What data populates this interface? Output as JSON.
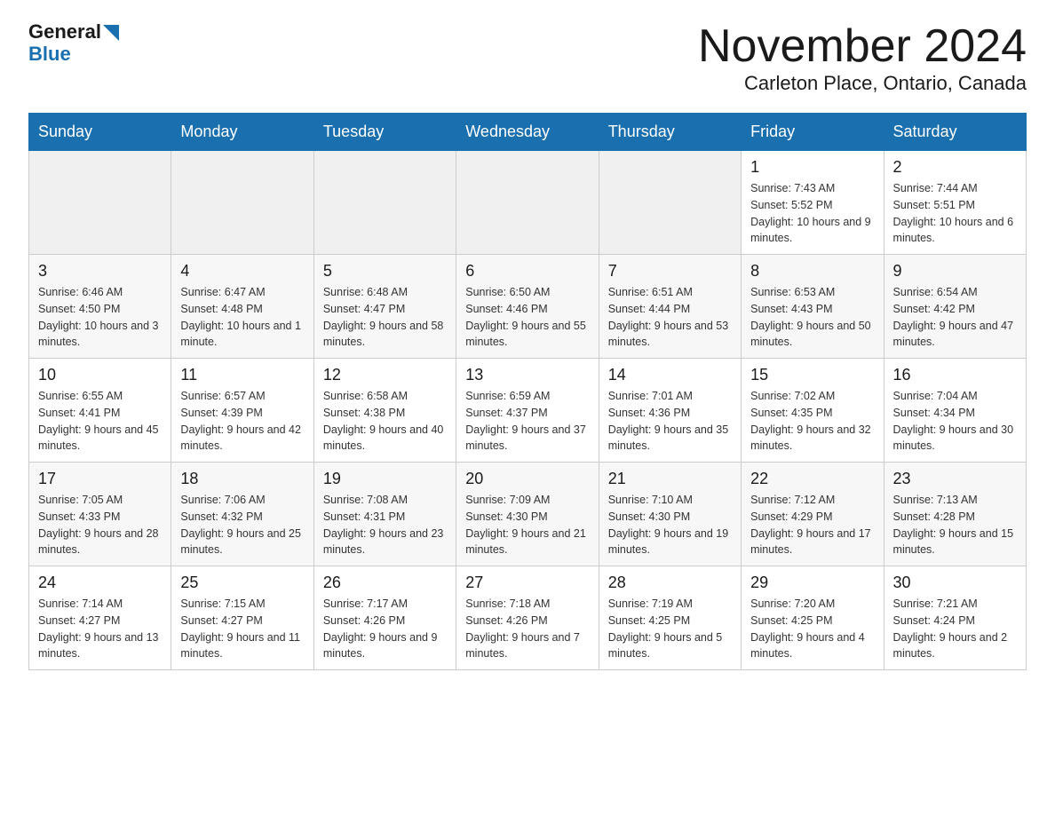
{
  "logo": {
    "line1": "General",
    "arrow": true,
    "line2": "Blue"
  },
  "title": "November 2024",
  "subtitle": "Carleton Place, Ontario, Canada",
  "days_of_week": [
    "Sunday",
    "Monday",
    "Tuesday",
    "Wednesday",
    "Thursday",
    "Friday",
    "Saturday"
  ],
  "weeks": [
    [
      {
        "day": "",
        "info": ""
      },
      {
        "day": "",
        "info": ""
      },
      {
        "day": "",
        "info": ""
      },
      {
        "day": "",
        "info": ""
      },
      {
        "day": "",
        "info": ""
      },
      {
        "day": "1",
        "info": "Sunrise: 7:43 AM\nSunset: 5:52 PM\nDaylight: 10 hours and 9 minutes."
      },
      {
        "day": "2",
        "info": "Sunrise: 7:44 AM\nSunset: 5:51 PM\nDaylight: 10 hours and 6 minutes."
      }
    ],
    [
      {
        "day": "3",
        "info": "Sunrise: 6:46 AM\nSunset: 4:50 PM\nDaylight: 10 hours and 3 minutes."
      },
      {
        "day": "4",
        "info": "Sunrise: 6:47 AM\nSunset: 4:48 PM\nDaylight: 10 hours and 1 minute."
      },
      {
        "day": "5",
        "info": "Sunrise: 6:48 AM\nSunset: 4:47 PM\nDaylight: 9 hours and 58 minutes."
      },
      {
        "day": "6",
        "info": "Sunrise: 6:50 AM\nSunset: 4:46 PM\nDaylight: 9 hours and 55 minutes."
      },
      {
        "day": "7",
        "info": "Sunrise: 6:51 AM\nSunset: 4:44 PM\nDaylight: 9 hours and 53 minutes."
      },
      {
        "day": "8",
        "info": "Sunrise: 6:53 AM\nSunset: 4:43 PM\nDaylight: 9 hours and 50 minutes."
      },
      {
        "day": "9",
        "info": "Sunrise: 6:54 AM\nSunset: 4:42 PM\nDaylight: 9 hours and 47 minutes."
      }
    ],
    [
      {
        "day": "10",
        "info": "Sunrise: 6:55 AM\nSunset: 4:41 PM\nDaylight: 9 hours and 45 minutes."
      },
      {
        "day": "11",
        "info": "Sunrise: 6:57 AM\nSunset: 4:39 PM\nDaylight: 9 hours and 42 minutes."
      },
      {
        "day": "12",
        "info": "Sunrise: 6:58 AM\nSunset: 4:38 PM\nDaylight: 9 hours and 40 minutes."
      },
      {
        "day": "13",
        "info": "Sunrise: 6:59 AM\nSunset: 4:37 PM\nDaylight: 9 hours and 37 minutes."
      },
      {
        "day": "14",
        "info": "Sunrise: 7:01 AM\nSunset: 4:36 PM\nDaylight: 9 hours and 35 minutes."
      },
      {
        "day": "15",
        "info": "Sunrise: 7:02 AM\nSunset: 4:35 PM\nDaylight: 9 hours and 32 minutes."
      },
      {
        "day": "16",
        "info": "Sunrise: 7:04 AM\nSunset: 4:34 PM\nDaylight: 9 hours and 30 minutes."
      }
    ],
    [
      {
        "day": "17",
        "info": "Sunrise: 7:05 AM\nSunset: 4:33 PM\nDaylight: 9 hours and 28 minutes."
      },
      {
        "day": "18",
        "info": "Sunrise: 7:06 AM\nSunset: 4:32 PM\nDaylight: 9 hours and 25 minutes."
      },
      {
        "day": "19",
        "info": "Sunrise: 7:08 AM\nSunset: 4:31 PM\nDaylight: 9 hours and 23 minutes."
      },
      {
        "day": "20",
        "info": "Sunrise: 7:09 AM\nSunset: 4:30 PM\nDaylight: 9 hours and 21 minutes."
      },
      {
        "day": "21",
        "info": "Sunrise: 7:10 AM\nSunset: 4:30 PM\nDaylight: 9 hours and 19 minutes."
      },
      {
        "day": "22",
        "info": "Sunrise: 7:12 AM\nSunset: 4:29 PM\nDaylight: 9 hours and 17 minutes."
      },
      {
        "day": "23",
        "info": "Sunrise: 7:13 AM\nSunset: 4:28 PM\nDaylight: 9 hours and 15 minutes."
      }
    ],
    [
      {
        "day": "24",
        "info": "Sunrise: 7:14 AM\nSunset: 4:27 PM\nDaylight: 9 hours and 13 minutes."
      },
      {
        "day": "25",
        "info": "Sunrise: 7:15 AM\nSunset: 4:27 PM\nDaylight: 9 hours and 11 minutes."
      },
      {
        "day": "26",
        "info": "Sunrise: 7:17 AM\nSunset: 4:26 PM\nDaylight: 9 hours and 9 minutes."
      },
      {
        "day": "27",
        "info": "Sunrise: 7:18 AM\nSunset: 4:26 PM\nDaylight: 9 hours and 7 minutes."
      },
      {
        "day": "28",
        "info": "Sunrise: 7:19 AM\nSunset: 4:25 PM\nDaylight: 9 hours and 5 minutes."
      },
      {
        "day": "29",
        "info": "Sunrise: 7:20 AM\nSunset: 4:25 PM\nDaylight: 9 hours and 4 minutes."
      },
      {
        "day": "30",
        "info": "Sunrise: 7:21 AM\nSunset: 4:24 PM\nDaylight: 9 hours and 2 minutes."
      }
    ]
  ]
}
